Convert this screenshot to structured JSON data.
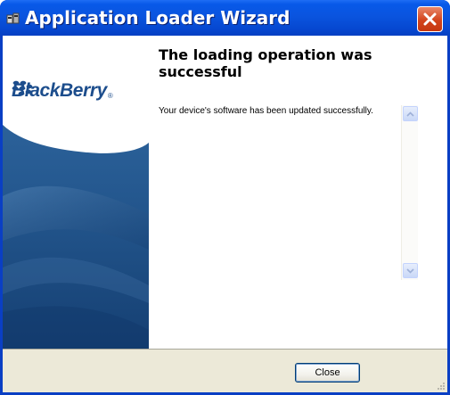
{
  "window": {
    "title": "Application Loader Wizard",
    "app_icon": "application-loader-icon",
    "close_icon": "close-icon"
  },
  "side_panel": {
    "logo_text": "BlackBerry",
    "logo_reg": "®",
    "logo_icon": "blackberry-logo-icon"
  },
  "main": {
    "heading": "The loading operation was successful",
    "message": "Your device's software has been updated successfully.",
    "scroll_up_icon": "scroll-up-arrow-icon",
    "scroll_down_icon": "scroll-down-arrow-icon"
  },
  "footer": {
    "close_label": "Close",
    "grip_icon": "resize-grip-icon"
  },
  "colors": {
    "titlebar": "#0A54DF",
    "close_button": "#D3441C",
    "footer_bg": "#ECE9D8",
    "panel_blue": "#2B6199",
    "logo_blue": "#1C4D8C"
  }
}
